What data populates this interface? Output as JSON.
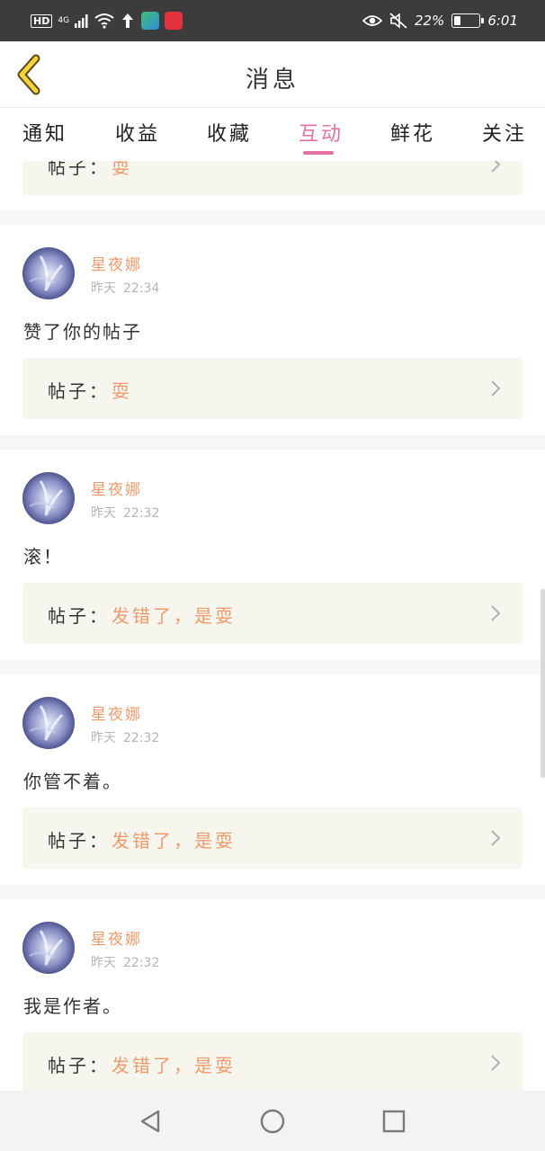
{
  "status_bar": {
    "hd": "HD",
    "network": "4G",
    "battery_percent": "22%",
    "battery_level": 0.22,
    "time": "6:01",
    "icons": [
      "signal-icon",
      "wifi-icon",
      "usb-icon",
      "video-app-icon",
      "news-app-icon",
      "eye-icon",
      "mute-icon",
      "battery-icon"
    ]
  },
  "header": {
    "title": "消息",
    "back_icon": "chevron-left-icon"
  },
  "tabs": [
    {
      "label": "通知",
      "active": false
    },
    {
      "label": "收益",
      "active": false
    },
    {
      "label": "收藏",
      "active": false
    },
    {
      "label": "互动",
      "active": true
    },
    {
      "label": "鲜花",
      "active": false
    },
    {
      "label": "关注",
      "active": false
    }
  ],
  "partial_card": {
    "label": "帖子：",
    "title": "耍"
  },
  "post_label": "帖子：",
  "items": [
    {
      "user": "星夜娜",
      "day": "昨天",
      "time": "22:34",
      "message": "赞了你的帖子",
      "post_title": "耍"
    },
    {
      "user": "星夜娜",
      "day": "昨天",
      "time": "22:32",
      "message": "滚！",
      "post_title": "发错了，是耍"
    },
    {
      "user": "星夜娜",
      "day": "昨天",
      "time": "22:32",
      "message": "你管不着。",
      "post_title": "发错了，是耍"
    },
    {
      "user": "星夜娜",
      "day": "昨天",
      "time": "22:32",
      "message": "我是作者。",
      "post_title": "发错了，是耍"
    }
  ],
  "colors": {
    "accent_pink": "#e76fa5",
    "username_orange": "#f09a6c",
    "card_bg": "#f6f6ee",
    "status_bar": "#3c3c3c"
  },
  "system_nav": [
    "back-triangle-icon",
    "home-circle-icon",
    "recents-square-icon"
  ]
}
